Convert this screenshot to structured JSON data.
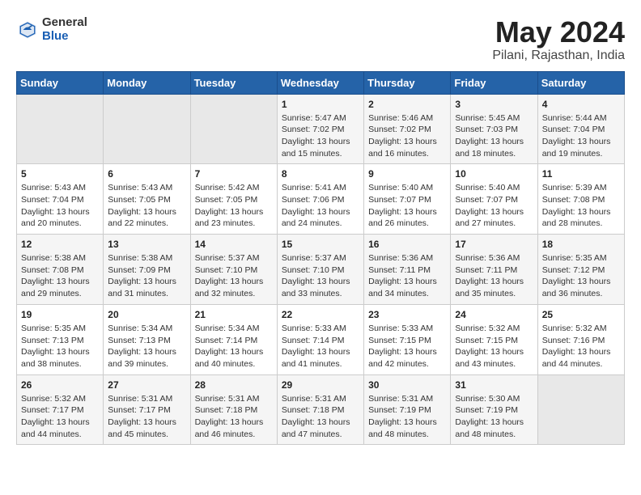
{
  "header": {
    "logo_general": "General",
    "logo_blue": "Blue",
    "month": "May 2024",
    "location": "Pilani, Rajasthan, India"
  },
  "weekdays": [
    "Sunday",
    "Monday",
    "Tuesday",
    "Wednesday",
    "Thursday",
    "Friday",
    "Saturday"
  ],
  "weeks": [
    [
      {
        "day": "",
        "empty": true
      },
      {
        "day": "",
        "empty": true
      },
      {
        "day": "",
        "empty": true
      },
      {
        "day": "1",
        "sunrise": "5:47 AM",
        "sunset": "7:02 PM",
        "daylight": "13 hours and 15 minutes."
      },
      {
        "day": "2",
        "sunrise": "5:46 AM",
        "sunset": "7:02 PM",
        "daylight": "13 hours and 16 minutes."
      },
      {
        "day": "3",
        "sunrise": "5:45 AM",
        "sunset": "7:03 PM",
        "daylight": "13 hours and 18 minutes."
      },
      {
        "day": "4",
        "sunrise": "5:44 AM",
        "sunset": "7:04 PM",
        "daylight": "13 hours and 19 minutes."
      }
    ],
    [
      {
        "day": "5",
        "sunrise": "5:43 AM",
        "sunset": "7:04 PM",
        "daylight": "13 hours and 20 minutes."
      },
      {
        "day": "6",
        "sunrise": "5:43 AM",
        "sunset": "7:05 PM",
        "daylight": "13 hours and 22 minutes."
      },
      {
        "day": "7",
        "sunrise": "5:42 AM",
        "sunset": "7:05 PM",
        "daylight": "13 hours and 23 minutes."
      },
      {
        "day": "8",
        "sunrise": "5:41 AM",
        "sunset": "7:06 PM",
        "daylight": "13 hours and 24 minutes."
      },
      {
        "day": "9",
        "sunrise": "5:40 AM",
        "sunset": "7:07 PM",
        "daylight": "13 hours and 26 minutes."
      },
      {
        "day": "10",
        "sunrise": "5:40 AM",
        "sunset": "7:07 PM",
        "daylight": "13 hours and 27 minutes."
      },
      {
        "day": "11",
        "sunrise": "5:39 AM",
        "sunset": "7:08 PM",
        "daylight": "13 hours and 28 minutes."
      }
    ],
    [
      {
        "day": "12",
        "sunrise": "5:38 AM",
        "sunset": "7:08 PM",
        "daylight": "13 hours and 29 minutes."
      },
      {
        "day": "13",
        "sunrise": "5:38 AM",
        "sunset": "7:09 PM",
        "daylight": "13 hours and 31 minutes."
      },
      {
        "day": "14",
        "sunrise": "5:37 AM",
        "sunset": "7:10 PM",
        "daylight": "13 hours and 32 minutes."
      },
      {
        "day": "15",
        "sunrise": "5:37 AM",
        "sunset": "7:10 PM",
        "daylight": "13 hours and 33 minutes."
      },
      {
        "day": "16",
        "sunrise": "5:36 AM",
        "sunset": "7:11 PM",
        "daylight": "13 hours and 34 minutes."
      },
      {
        "day": "17",
        "sunrise": "5:36 AM",
        "sunset": "7:11 PM",
        "daylight": "13 hours and 35 minutes."
      },
      {
        "day": "18",
        "sunrise": "5:35 AM",
        "sunset": "7:12 PM",
        "daylight": "13 hours and 36 minutes."
      }
    ],
    [
      {
        "day": "19",
        "sunrise": "5:35 AM",
        "sunset": "7:13 PM",
        "daylight": "13 hours and 38 minutes."
      },
      {
        "day": "20",
        "sunrise": "5:34 AM",
        "sunset": "7:13 PM",
        "daylight": "13 hours and 39 minutes."
      },
      {
        "day": "21",
        "sunrise": "5:34 AM",
        "sunset": "7:14 PM",
        "daylight": "13 hours and 40 minutes."
      },
      {
        "day": "22",
        "sunrise": "5:33 AM",
        "sunset": "7:14 PM",
        "daylight": "13 hours and 41 minutes."
      },
      {
        "day": "23",
        "sunrise": "5:33 AM",
        "sunset": "7:15 PM",
        "daylight": "13 hours and 42 minutes."
      },
      {
        "day": "24",
        "sunrise": "5:32 AM",
        "sunset": "7:15 PM",
        "daylight": "13 hours and 43 minutes."
      },
      {
        "day": "25",
        "sunrise": "5:32 AM",
        "sunset": "7:16 PM",
        "daylight": "13 hours and 44 minutes."
      }
    ],
    [
      {
        "day": "26",
        "sunrise": "5:32 AM",
        "sunset": "7:17 PM",
        "daylight": "13 hours and 44 minutes."
      },
      {
        "day": "27",
        "sunrise": "5:31 AM",
        "sunset": "7:17 PM",
        "daylight": "13 hours and 45 minutes."
      },
      {
        "day": "28",
        "sunrise": "5:31 AM",
        "sunset": "7:18 PM",
        "daylight": "13 hours and 46 minutes."
      },
      {
        "day": "29",
        "sunrise": "5:31 AM",
        "sunset": "7:18 PM",
        "daylight": "13 hours and 47 minutes."
      },
      {
        "day": "30",
        "sunrise": "5:31 AM",
        "sunset": "7:19 PM",
        "daylight": "13 hours and 48 minutes."
      },
      {
        "day": "31",
        "sunrise": "5:30 AM",
        "sunset": "7:19 PM",
        "daylight": "13 hours and 48 minutes."
      },
      {
        "day": "",
        "empty": true
      }
    ]
  ]
}
